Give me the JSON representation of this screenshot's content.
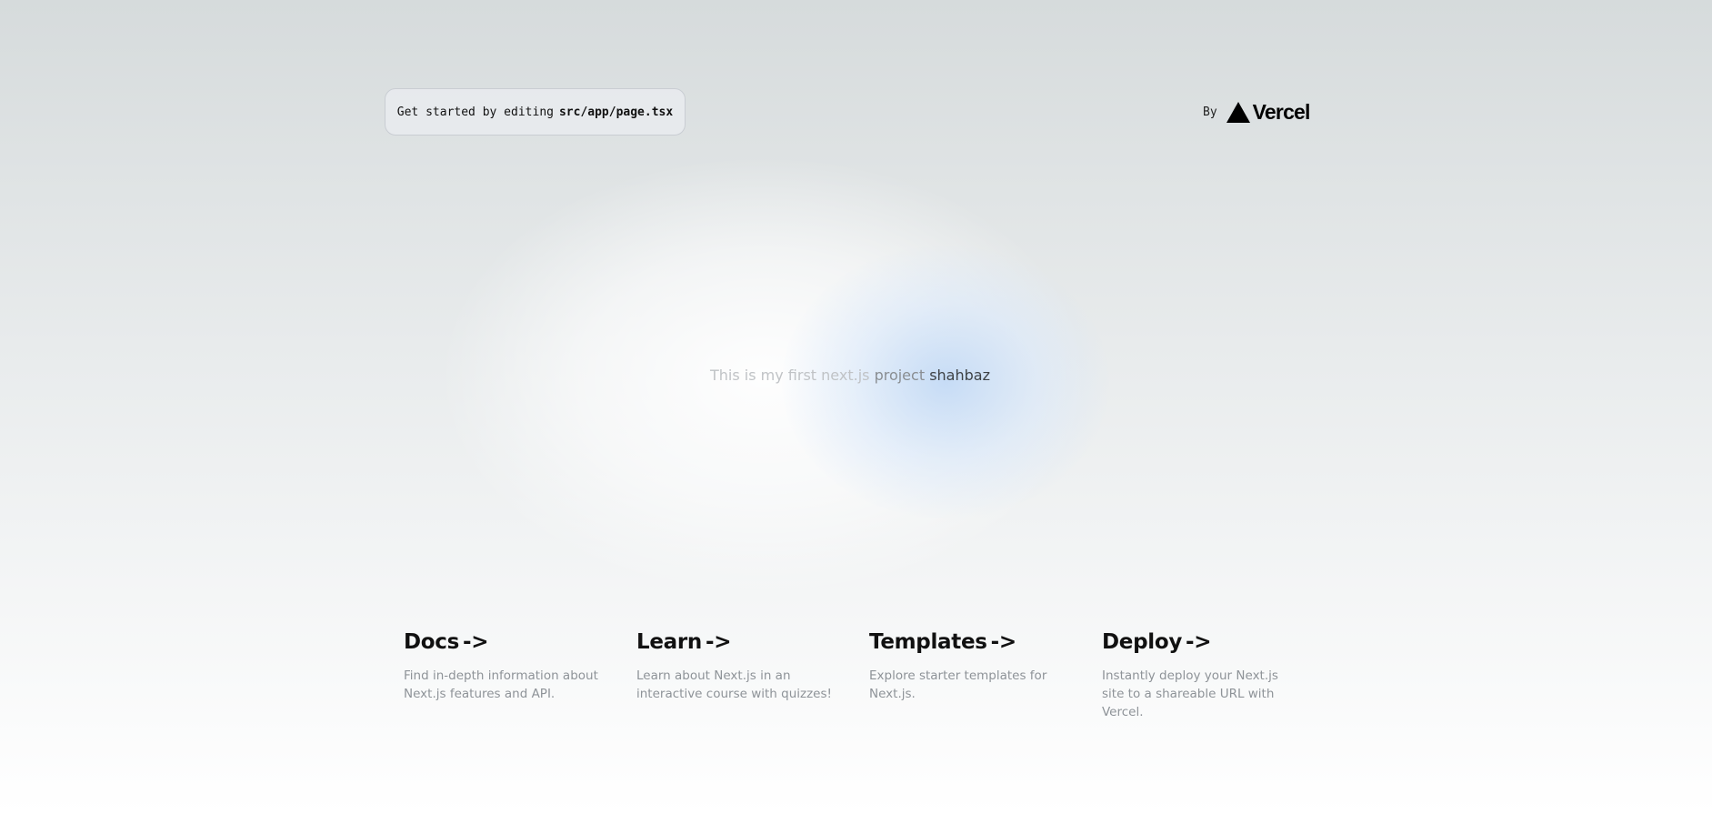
{
  "header": {
    "intro_text": "Get started by editing",
    "file_path": "src/app/page.tsx",
    "by_label": "By",
    "brand_name": "Vercel",
    "brand_icon": "vercel-triangle-icon"
  },
  "hero": {
    "part1": "This is my first next.js",
    "part2": "project",
    "part3": "shahbaz"
  },
  "cards": [
    {
      "title": "Docs",
      "arrow": "->",
      "description": "Find in-depth information about Next.js features and API."
    },
    {
      "title": "Learn",
      "arrow": "->",
      "description": "Learn about Next.js in an interactive course with quizzes!"
    },
    {
      "title": "Templates",
      "arrow": "->",
      "description": "Explore starter templates for Next.js."
    },
    {
      "title": "Deploy",
      "arrow": "->",
      "description": "Instantly deploy your Next.js site to a shareable URL with Vercel."
    }
  ],
  "colors": {
    "background_top": "#d6dbdc",
    "background_bottom": "#ffffff",
    "glow_blue": "#bed7f5",
    "text_muted": "#8e9398"
  }
}
